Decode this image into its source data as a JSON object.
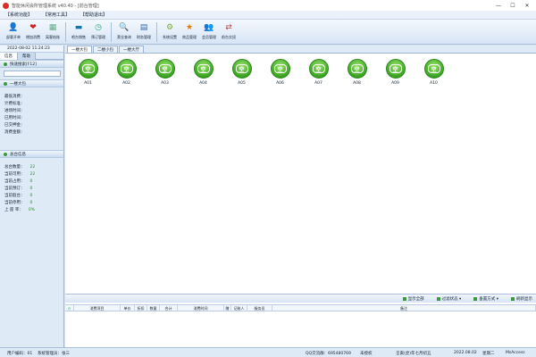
{
  "window": {
    "title": "智能休闲会所管理系统 v40.40 - [前台管理]"
  },
  "menu": [
    "【系统功能】",
    "【常用工具】",
    "【帮助退出】"
  ],
  "toolbar": [
    {
      "label": "部客开单",
      "icon": "customer-icon"
    },
    {
      "label": "增加消费",
      "icon": "add-consume-icon"
    },
    {
      "label": "离客结账",
      "icon": "checkout-icon"
    },
    {
      "label": "吧台销售",
      "icon": "bar-sales-icon"
    },
    {
      "label": "预订管理",
      "icon": "reservation-icon"
    },
    {
      "label": "营业查询",
      "icon": "search-icon"
    },
    {
      "label": "财务管理",
      "icon": "finance-icon"
    },
    {
      "label": "系统设置",
      "icon": "gear-icon"
    },
    {
      "label": "商品管理",
      "icon": "star-icon"
    },
    {
      "label": "会员管理",
      "icon": "members-icon"
    },
    {
      "label": "前台交班",
      "icon": "handover-icon"
    }
  ],
  "left": {
    "datetime": "2022-08-02 11:24:23",
    "tabs": [
      "信息",
      "帮助"
    ],
    "search_section": "快速搜索[F12]",
    "area_section": "一楼大包",
    "fields": [
      "最低消费：",
      "计费标准：",
      "进场时间：",
      "已用时间：",
      "已交押金：",
      "消费金额："
    ],
    "total_section": "总台信息",
    "stats": [
      {
        "label": "总台数量：",
        "value": "22"
      },
      {
        "label": "当前可用：",
        "value": "22"
      },
      {
        "label": "当前占用：",
        "value": "0"
      },
      {
        "label": "当前预订：",
        "value": "0"
      },
      {
        "label": "当前脏台：",
        "value": "0"
      },
      {
        "label": "当前停用：",
        "value": "0"
      },
      {
        "label": "上 座 率：",
        "value": "0%"
      }
    ]
  },
  "main": {
    "tabs": [
      "一楼大包",
      "二楼小包",
      "一楼大厅"
    ],
    "tables": [
      {
        "status": "空",
        "name": "A01"
      },
      {
        "status": "空",
        "name": "A02"
      },
      {
        "status": "空",
        "name": "A03"
      },
      {
        "status": "空",
        "name": "A04"
      },
      {
        "status": "空",
        "name": "A05"
      },
      {
        "status": "空",
        "name": "A06"
      },
      {
        "status": "空",
        "name": "A07"
      },
      {
        "status": "空",
        "name": "A08"
      },
      {
        "status": "空",
        "name": "A09"
      },
      {
        "status": "空",
        "name": "A10"
      }
    ],
    "bottom_actions": [
      "显示全部",
      "过滤状态 ▾",
      "垂置方式 ▾",
      "刷新显示"
    ],
    "grid_columns": [
      "消费项目",
      "单价",
      "折扣",
      "数量",
      "合计",
      "消费时间",
      "赠",
      "记账人",
      "服务员",
      "备注"
    ]
  },
  "status": {
    "user": "用户编码：01",
    "operator": "系统管理员：张三",
    "qq": "QQ交流群：695480769",
    "license": "未授权",
    "lunar": "壬寅(虎)年七月初五",
    "date": "2022.08.02",
    "weekday": "星期二",
    "db": "MsAccess"
  }
}
